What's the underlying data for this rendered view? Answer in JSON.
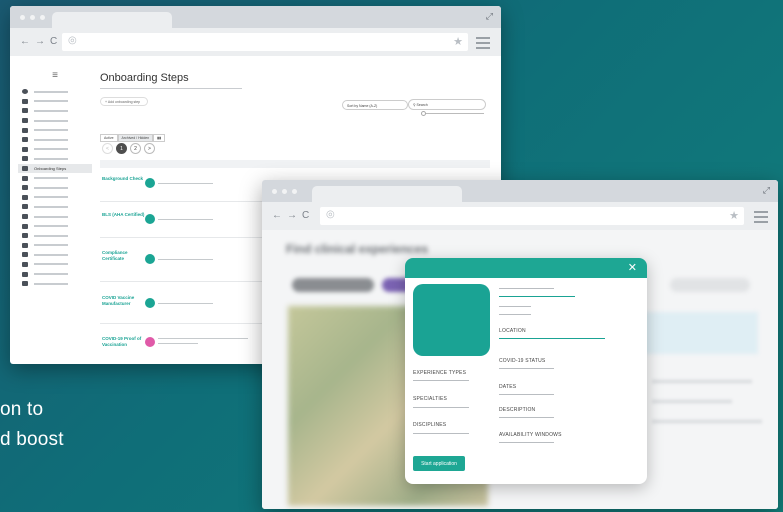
{
  "background_text": {
    "line1": "on to",
    "line2": "d boost"
  },
  "window1": {
    "page_title": "Onboarding Steps",
    "add_button": "+ Add onboarding step",
    "sort_label": "Sort by Name (A-Z)",
    "search_placeholder": "Search",
    "view_active": "Active",
    "view_archived": "Archived / Hidden",
    "pager": {
      "page1": "1",
      "page2": "2",
      "next": ">",
      "prev": "<"
    },
    "sidebar_active": "Onboarding Steps",
    "rows": [
      {
        "name": "Background Check",
        "status_color": "#1ba594"
      },
      {
        "name": "BLS (AHA Certified)",
        "status_color": "#1ba594"
      },
      {
        "name": "Compliance Certificate",
        "status_color": "#1ba594"
      },
      {
        "name": "COVID Vaccine Manufacturer",
        "status_color": "#1ba594"
      },
      {
        "name": "COVID-19 Proof of Vaccination",
        "status_color": "#e05aa8"
      }
    ]
  },
  "window2": {
    "blurred_title": "Find clinical experiences",
    "modal": {
      "close": "✕",
      "location": "LOCATION",
      "covid_status": "COVID-19 STATUS",
      "dates": "DATES",
      "description": "DESCRIPTION",
      "availability": "AVAILABILITY WINDOWS",
      "experience_types": "EXPERIENCE TYPES",
      "specialties": "SPECIALTIES",
      "disciplines": "DISCIPLINES",
      "start_button": "Start application"
    }
  },
  "colors": {
    "accent": "#1ea794",
    "pink": "#e05aa8"
  }
}
